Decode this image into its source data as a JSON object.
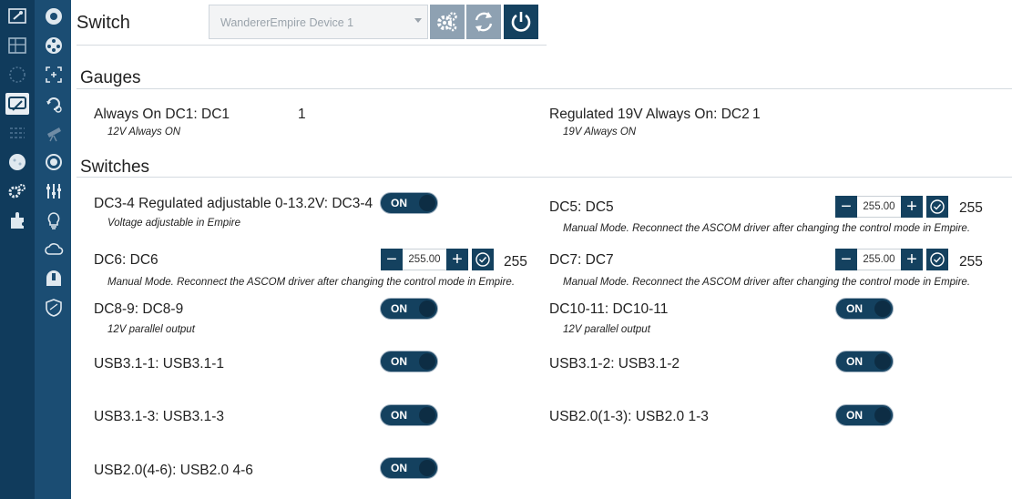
{
  "header": {
    "title": "Switch",
    "device": "WandererEmpire Device 1"
  },
  "gauges": {
    "heading": "Gauges",
    "items": [
      {
        "label": "Always On DC1: DC1",
        "value": "1",
        "description": "12V Always ON"
      },
      {
        "label": "Regulated 19V Always On: DC2",
        "value": "1",
        "description": "19V Always ON"
      }
    ]
  },
  "switches": {
    "heading": "Switches",
    "toggle_on_text": "ON",
    "items": [
      {
        "label": "DC3-4 Regulated adjustable 0-13.2V: DC3-4",
        "description": "Voltage adjustable in Empire",
        "state": "ON"
      },
      {
        "label": "DC5: DC5",
        "description": "Manual Mode. Reconnect the ASCOM driver after changing the control mode in Empire.",
        "field": "255.00",
        "value": "255"
      },
      {
        "label": "DC6: DC6",
        "description": "Manual Mode. Reconnect the ASCOM driver after changing the control mode in Empire.",
        "field": "255.00",
        "value": "255"
      },
      {
        "label": "DC7: DC7",
        "description": "Manual Mode. Reconnect the ASCOM driver after changing the control mode in Empire.",
        "field": "255.00",
        "value": "255"
      },
      {
        "label": "DC8-9: DC8-9",
        "description": "12V parallel output",
        "state": "ON"
      },
      {
        "label": "DC10-11: DC10-11",
        "description": "12V parallel output",
        "state": "ON"
      },
      {
        "label": "USB3.1-1: USB3.1-1",
        "state": "ON"
      },
      {
        "label": "USB3.1-2: USB3.1-2",
        "state": "ON"
      },
      {
        "label": "USB3.1-3: USB3.1-3",
        "state": "ON"
      },
      {
        "label": "USB2.0(1-3): USB2.0 1-3",
        "state": "ON"
      },
      {
        "label": "USB2.0(4-6): USB2.0 4-6",
        "state": "ON"
      }
    ]
  },
  "icons": {
    "rail1": [
      "equipment-icon",
      "map-icon",
      "sky-atlas-icon",
      "imaging-icon",
      "options-icon",
      "globe-icon",
      "settings-icon",
      "plugins-icon"
    ],
    "rail2": [
      "camera-icon",
      "filter-wheel-icon",
      "focuser-icon",
      "rotator-icon",
      "telescope-icon",
      "guider-icon",
      "switch-icon",
      "flat-device-icon",
      "weather-icon",
      "dome-icon",
      "safety-monitor-icon"
    ]
  },
  "colors": {
    "accent": "#14415f",
    "rail_dark": "#103b5c",
    "rail_light": "#1b4d73"
  }
}
